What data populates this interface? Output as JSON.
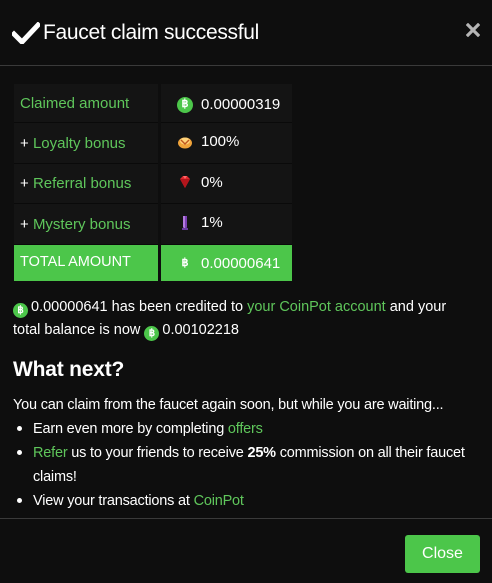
{
  "dialog": {
    "title": "Faucet claim successful"
  },
  "table": {
    "rows": [
      {
        "label": "Claimed amount",
        "plus": "",
        "value": "0.00000319",
        "icon": "bitcoin-icon"
      },
      {
        "label": "Loyalty bonus",
        "plus": "+ ",
        "value": "100%",
        "icon": "loyalty-icon"
      },
      {
        "label": "Referral bonus",
        "plus": "+ ",
        "value": "0%",
        "icon": "ruby-icon"
      },
      {
        "label": "Mystery bonus",
        "plus": "+ ",
        "value": "1%",
        "icon": "crystal-icon"
      }
    ],
    "total": {
      "label": "TOTAL AMOUNT",
      "value": "0.00000641",
      "icon": "bitcoin-icon"
    }
  },
  "credited": {
    "amount": "0.00000641",
    "text1": " has been credited to ",
    "link": "your CoinPot account",
    "text2": " and your total balance is now ",
    "balance": "0.00102218"
  },
  "next": {
    "heading": "What next?",
    "intro": "You can claim from the faucet again soon, but while you are waiting...",
    "item1_pre": "Earn even more by completing ",
    "item1_link": "offers",
    "item2_link": "Refer",
    "item2_mid": " us to your friends to receive ",
    "item2_bold": "25%",
    "item2_post": " commission on all their faucet claims!",
    "item3_pre": "View your transactions at ",
    "item3_link": "CoinPot"
  },
  "footer": {
    "close_label": "Close"
  },
  "colors": {
    "accent": "#4cc64a",
    "link": "#5fc65b",
    "background": "#0e0e0e"
  }
}
